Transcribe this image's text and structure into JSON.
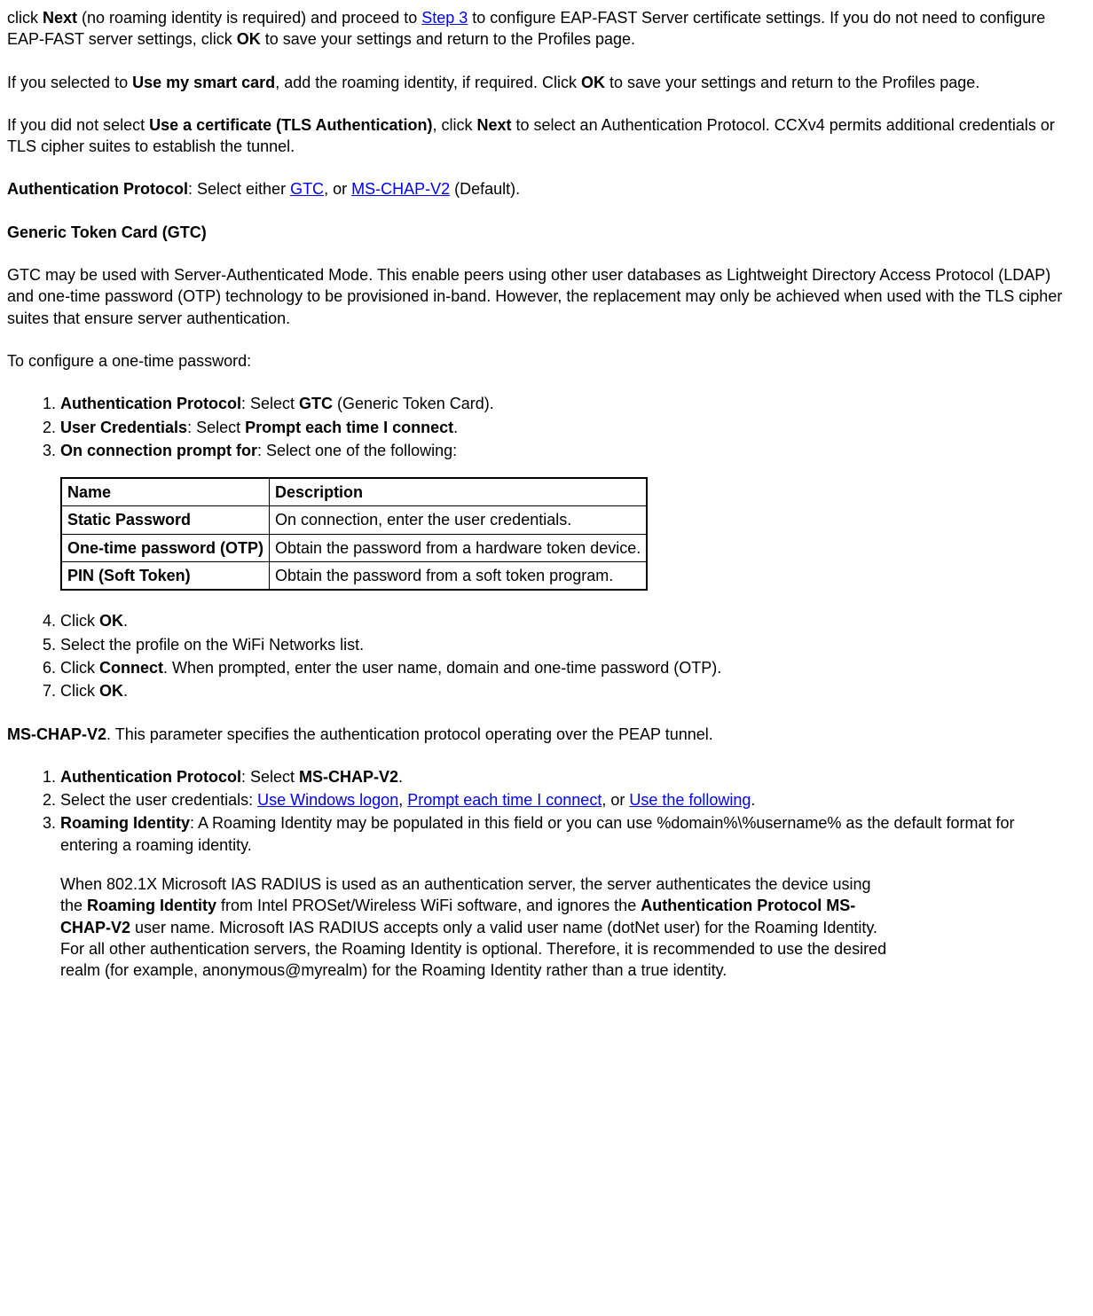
{
  "p1_pre": "click ",
  "p1_b_next": "Next",
  "p1_mid1": " (no roaming identity is required) and proceed to ",
  "p1_link_step3": "Step 3",
  "p1_mid2": " to configure EAP-FAST Server certificate settings. If you do not need to configure EAP-FAST server settings, click ",
  "p1_b_ok": "OK",
  "p1_end": " to save your settings and return to the Profiles page.",
  "p2_pre": "If you selected to ",
  "p2_b_smart": "Use my smart card",
  "p2_mid": ", add the roaming identity, if required. Click ",
  "p2_b_ok": "OK",
  "p2_end": " to save your settings and return to the Profiles page.",
  "p3_pre": "If you did not select ",
  "p3_b_cert": "Use a certificate (TLS Authentication)",
  "p3_mid": ", click ",
  "p3_b_next": "Next",
  "p3_end": " to select an Authentication Protocol. CCXv4 permits additional credentials or TLS cipher suites to establish the tunnel.",
  "p4_b_auth": "Authentication Protocol",
  "p4_mid1": ": Select either ",
  "p4_link_gtc": "GTC",
  "p4_mid2": ", or ",
  "p4_link_mschap": "MS-CHAP-V2",
  "p4_end": " (Default).",
  "gtc_head": "Generic Token Card (GTC)",
  "gtc_desc": "GTC may be used with Server-Authenticated Mode. This enable peers using other user databases as Lightweight Directory Access Protocol (LDAP) and one-time password (OTP) technology to be provisioned in-band. However, the replacement may only be achieved when used with the TLS cipher suites that ensure server authentication.",
  "otp_intro": "To configure a one-time password:",
  "ol1_1_b1": "Authentication Protocol",
  "ol1_1_mid": ": Select ",
  "ol1_1_b2": "GTC",
  "ol1_1_end": " (Generic Token Card).",
  "ol1_2_b1": "User Credentials",
  "ol1_2_mid": ": Select ",
  "ol1_2_b2": "Prompt each time I connect",
  "ol1_2_end": ".",
  "ol1_3_b1": "On connection prompt for",
  "ol1_3_end": ": Select one of the following:",
  "tbl_h_name": "Name",
  "tbl_h_desc": "Description",
  "tbl_r1_name": "Static Password",
  "tbl_r1_desc": "On connection, enter the user credentials.",
  "tbl_r2_name": "One-time password (OTP)",
  "tbl_r2_desc": "Obtain the password from a hardware token device.",
  "tbl_r3_name": "PIN (Soft Token)",
  "tbl_r3_desc": "Obtain the password from a soft token program.",
  "ol1_4_pre": "Click ",
  "ol1_4_b_ok": "OK",
  "ol1_4_end": ".",
  "ol1_5": "Select the profile on the WiFi Networks list.",
  "ol1_6_pre": "Click ",
  "ol1_6_b_connect": "Connect",
  "ol1_6_end": ". When prompted, enter the user name, domain and one-time password (OTP).",
  "ol1_7_pre": "Click ",
  "ol1_7_b_ok": "OK",
  "ol1_7_end": ".",
  "ms_head_b": "MS-CHAP-V2",
  "ms_head_end": ". This parameter specifies the authentication protocol operating over the PEAP tunnel.",
  "ol2_1_b1": "Authentication Protocol",
  "ol2_1_mid": ": Select ",
  "ol2_1_b2": "MS-CHAP-V2",
  "ol2_1_end": ".",
  "ol2_2_pre": "Select the user credentials: ",
  "ol2_2_link1": "Use Windows logon",
  "ol2_2_sep1": ", ",
  "ol2_2_link2": "Prompt each time I connect",
  "ol2_2_sep2": ", or ",
  "ol2_2_link3": "Use the following",
  "ol2_2_end": ".",
  "ol2_3_b1": "Roaming Identity",
  "ol2_3_end": ": A Roaming Identity may be populated in this field or you can use %domain%\\%username% as the default format for entering a roaming identity.",
  "ol2_3_para_pre": "When 802.1X Microsoft IAS RADIUS is used as an authentication server, the server authenticates the device using the ",
  "ol2_3_para_b1": "Roaming Identity",
  "ol2_3_para_mid1": " from Intel PROSet/Wireless WiFi software, and ignores the ",
  "ol2_3_para_b2": "Authentication Protocol MS-CHAP-V2",
  "ol2_3_para_end": " user name. Microsoft IAS RADIUS accepts only a valid user name (dotNet user) for the Roaming Identity. For all other authentication servers, the Roaming Identity is optional. Therefore, it is recommended to use the desired realm (for example, anonymous@myrealm) for the Roaming Identity rather than a true identity."
}
